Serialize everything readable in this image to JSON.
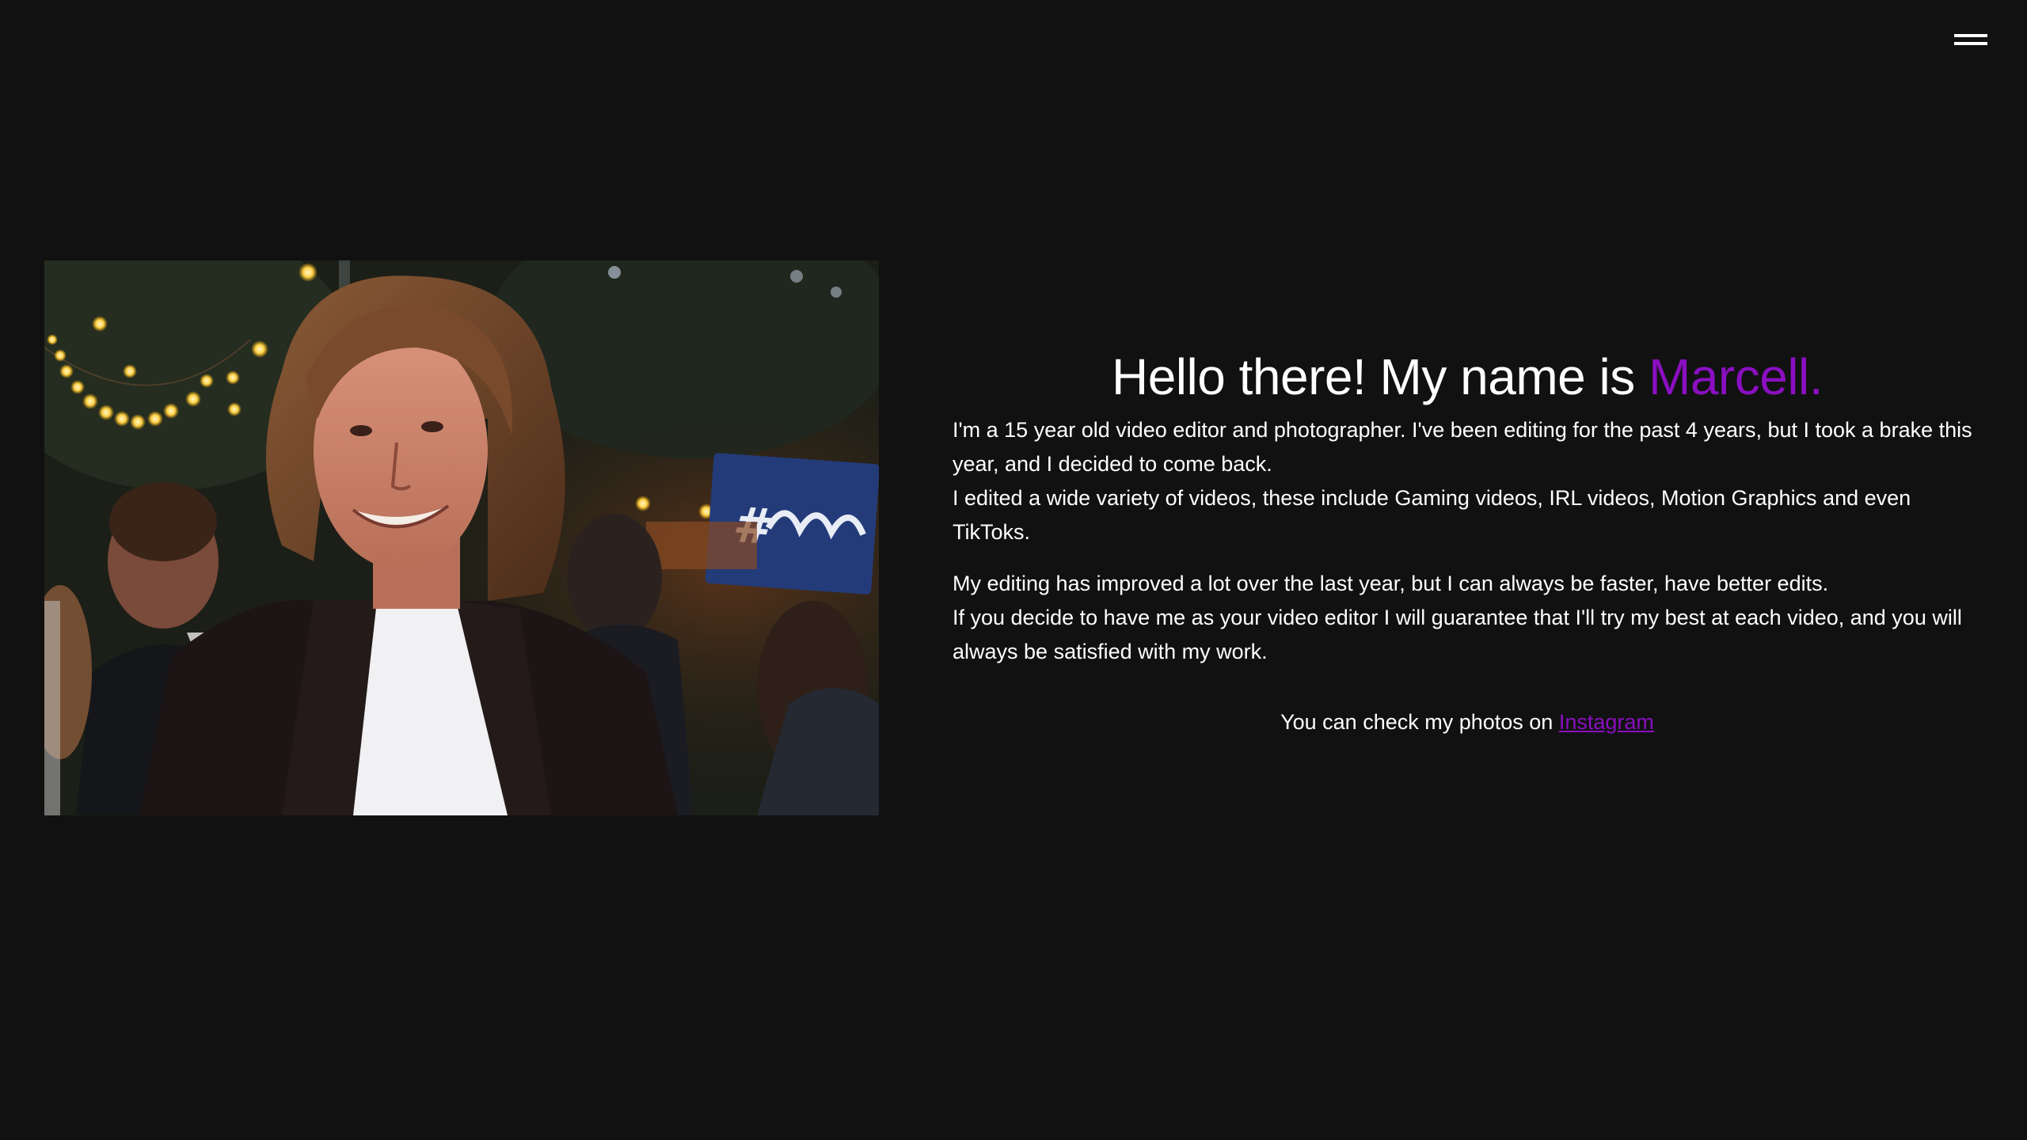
{
  "header": {
    "menu_icon": "hamburger-menu-icon"
  },
  "about": {
    "photo_alt": "Portrait of Marcell",
    "headline_prefix": "Hello there! My name is ",
    "headline_name": "Marcell.",
    "paragraph1": "I'm a 15 year old video editor and photographer. I've been editing for the past 4 years, but I took a brake this year, and I decided to come back.",
    "paragraph2": "I edited a wide variety of videos, these include Gaming videos, IRL videos, Motion Graphics and even TikToks.",
    "paragraph3": "My editing has improved a lot over the last year, but I can always be faster, have better edits.",
    "paragraph4": "If you decide to have me as your video editor I will guarantee that I'll try my best at each video, and you will always be satisfied with my work.",
    "cta_prefix": "You can check my photos on ",
    "cta_link": "Instagram"
  },
  "colors": {
    "background": "#111111",
    "text": "#ffffff",
    "accent": "#8a0fc0"
  }
}
